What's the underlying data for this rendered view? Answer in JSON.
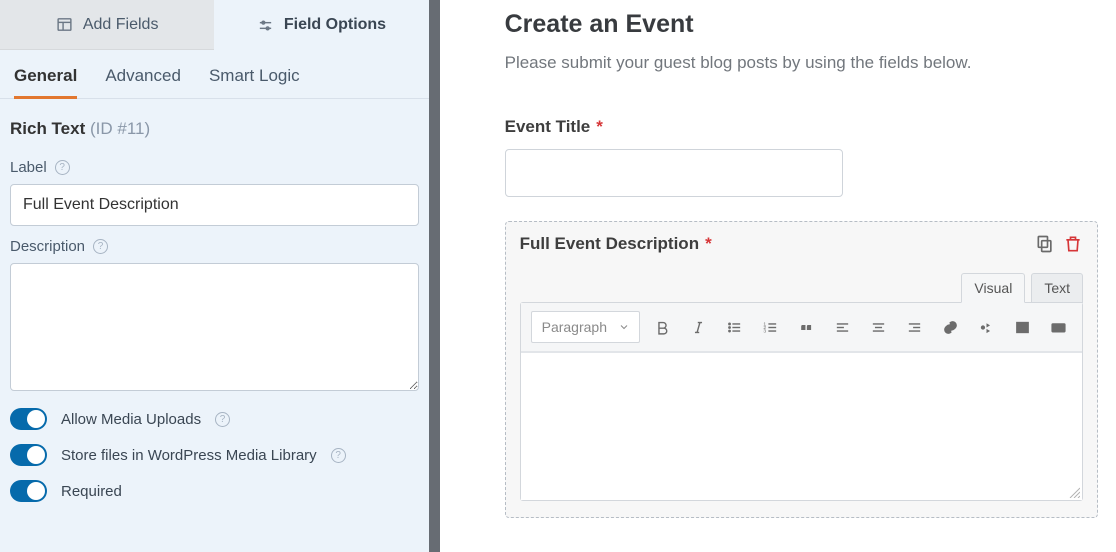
{
  "sidebar": {
    "tabs": {
      "add": "Add Fields",
      "options": "Field Options"
    },
    "subtabs": {
      "general": "General",
      "advanced": "Advanced",
      "logic": "Smart Logic"
    },
    "field_type": "Rich Text",
    "field_id": "(ID #11)",
    "label_text": "Label",
    "label_value": "Full Event Description",
    "description_text": "Description",
    "description_value": "",
    "toggles": {
      "media": "Allow Media Uploads",
      "store": "Store files in WordPress Media Library",
      "required": "Required"
    }
  },
  "preview": {
    "title": "Create an Event",
    "subtitle": "Please submit your guest blog posts by using the fields below.",
    "field1_label": "Event Title",
    "field2_label": "Full Event Description",
    "editor_tabs": {
      "visual": "Visual",
      "text": "Text"
    },
    "paragraph_dd": "Paragraph"
  }
}
